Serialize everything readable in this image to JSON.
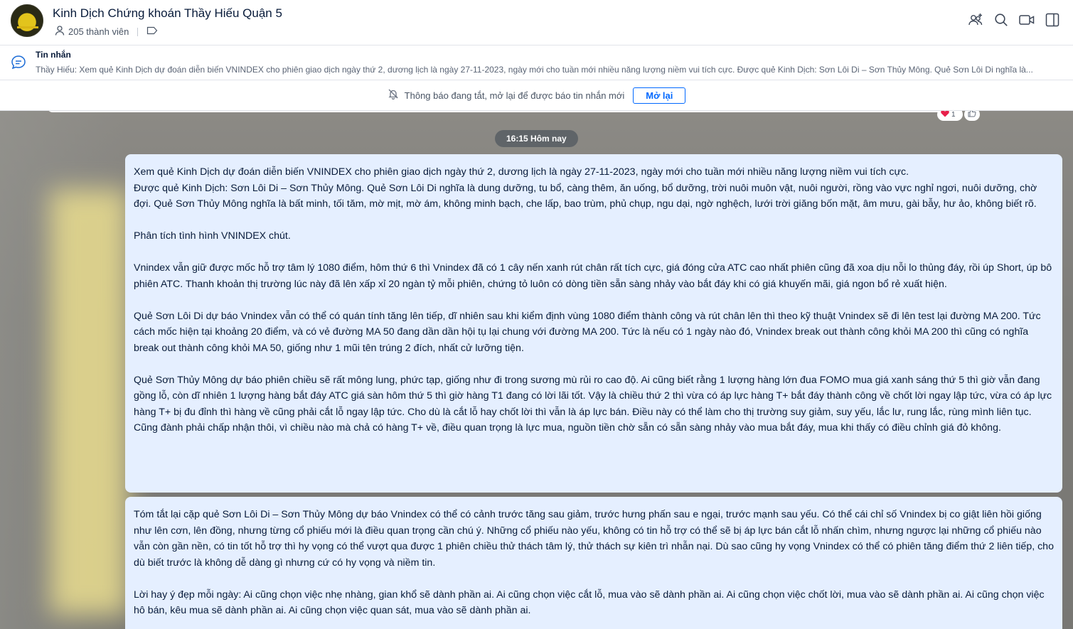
{
  "header": {
    "group_name": "Kinh Dịch Chứng khoán Thầy Hiếu Quận 5",
    "member_count": "205 thành viên",
    "icons": [
      "add-member-icon",
      "search-icon",
      "video-call-icon",
      "sidebar-toggle-icon"
    ]
  },
  "pinned": {
    "title": "Tin nhắn",
    "preview": "Thầy Hiếu: Xem quẻ Kinh Dịch dự đoán diễn biến VNINDEX cho phiên giao dịch ngày thứ 2, dương lịch là ngày 27-11-2023, ngày mới cho tuần mới nhiều năng lượng niềm vui tích cực. Được quẻ Kinh Dịch: Sơn Lôi Di – Sơn Thủy Mông. Quẻ Sơn Lôi Di nghĩa là..."
  },
  "notification": {
    "text": "Thông báo đang tắt, mở lại để được báo tin nhắn mới",
    "button": "Mở lại"
  },
  "reaction": {
    "heart_count": "1"
  },
  "time_divider": "16:15 Hôm nay",
  "messages": [
    {
      "paragraphs": [
        "Xem quẻ Kinh Dịch dự đoán diễn biến VNINDEX cho phiên giao dịch ngày thứ 2, dương lịch là ngày 27-11-2023, ngày mới cho tuần mới nhiều năng lượng niềm vui tích cực.",
        "Được quẻ Kinh Dịch: Sơn Lôi Di – Sơn Thủy Mông. Quẻ Sơn Lôi Di nghĩa là dung dưỡng, tu bổ, càng thêm, ăn uống, bổ dưỡng, trời nuôi muôn vật, nuôi người, rồng vào vực nghỉ ngơi, nuôi dưỡng, chờ đợi. Quẻ Sơn Thủy Mông nghĩa là bất minh, tối tăm, mờ mịt, mờ ám, không minh bạch, che lấp, bao trùm, phủ chụp, ngu dại, ngờ nghệch, lưới trời giăng bốn mặt, âm mưu, gài bẫy, hư ảo, không biết rõ.",
        "Phân tích tình hình VNINDEX chút.",
        "Vnindex vẫn giữ được mốc hỗ trợ tâm lý 1080 điểm, hôm thứ 6 thì Vnindex đã có 1 cây nến xanh rút chân rất tích cực, giá đóng cửa ATC cao nhất phiên cũng đã xoa dịu nỗi lo thủng đáy, rồi úp Short, úp bô phiên ATC. Thanh khoản thị trường lúc này đã lên xấp xỉ 20 ngàn tỷ mỗi phiên, chứng tỏ luôn có dòng tiền sẵn sàng nhảy vào bắt đáy khi có giá khuyến mãi, giá ngon bổ rẻ xuất hiện.",
        "Quẻ Sơn Lôi Di dự báo Vnindex vẫn có thể có quán tính tăng lên tiếp, dĩ nhiên sau khi kiểm định vùng 1080 điểm thành công và rút chân lên thì theo kỹ thuật Vnindex sẽ đi lên test lại đường MA 200. Tức cách mốc hiện tại khoảng 20 điểm, và có vẻ đường MA 50 đang dần dần hội tụ lại chung với đường MA 200. Tức là nếu có 1 ngày nào đó, Vnindex break out thành công khỏi MA 200 thì cũng có nghĩa break out thành công khỏi MA 50, giống như 1 mũi tên trúng 2 đích, nhất cử lưỡng tiện.",
        "Quẻ Sơn Thủy Mông dự báo phiên chiều sẽ rất mông lung, phức tạp, giống như đi trong sương mù rủi ro cao độ. Ai cũng biết rằng 1 lượng hàng lớn đua FOMO mua giá xanh sáng thứ 5 thì giờ vẫn đang gồng lỗ, còn dĩ nhiên 1 lượng hàng bắt đáy ATC giá sàn hôm thứ 5 thì giờ hàng T1 đang có lời lãi tốt. Vậy là chiều thứ 2 thì vừa có áp lực hàng T+ bắt đáy thành công về chốt lời ngay lập tức, vừa có áp lực hàng T+ bị đu đỉnh thì hàng về cũng phải cắt lỗ ngay lập tức. Cho dù là cắt lỗ hay chốt lời thì vẫn là áp lực bán. Điều này có thể làm cho thị trường suy giảm, suy yếu, lắc lư, rung lắc, rùng mình liên tục. Cũng đành phải chấp nhận thôi, vì chiều nào mà chả có hàng T+ về, điều quan trọng là lực mua, nguồn tiền chờ sẵn có sẵn sàng nhảy vào mua bắt đáy, mua khi thấy có điều chỉnh giá đỏ không."
      ]
    },
    {
      "paragraphs": [
        "Tóm tắt lại cặp quẻ Sơn Lôi Di – Sơn Thủy Mông dự báo Vnindex có thể có cảnh trước tăng sau giảm, trước hưng phấn sau e ngại, trước mạnh sau yếu. Có thể cái chỉ số Vnindex bị co giật liên hồi giống như lên cơn, lên đồng, nhưng từng cổ phiếu mới là điều quan trọng cần chú ý. Những cổ phiếu nào yếu, không có tin hỗ trợ có thể sẽ bị áp lực bán cắt lỗ nhấn chìm, nhưng ngược lại những cổ phiếu nào vẫn còn gần nền, có tin tốt hỗ trợ thì hy vọng có thể vượt qua được 1 phiên chiều thử thách tâm lý, thử thách sự kiên trì nhẫn nại. Dù sao cũng hy vọng Vnindex có thể có phiên tăng điểm thứ 2 liên tiếp, cho dù biết trước là không dễ dàng gì nhưng cứ có hy vọng và niềm tin.",
        "Lời hay ý đẹp mỗi ngày: Ai cũng chọn việc nhẹ nhàng, gian khổ sẽ dành phần ai. Ai cũng chọn việc cắt lỗ, mua vào sẽ dành phần ai. Ai cũng chọn việc chốt lời, mua vào sẽ dành phần ai. Ai cũng chọn việc hô bán, kêu mua sẽ dành phần ai. Ai cũng chọn việc quan sát, mua vào sẽ dành phần ai."
      ]
    }
  ]
}
